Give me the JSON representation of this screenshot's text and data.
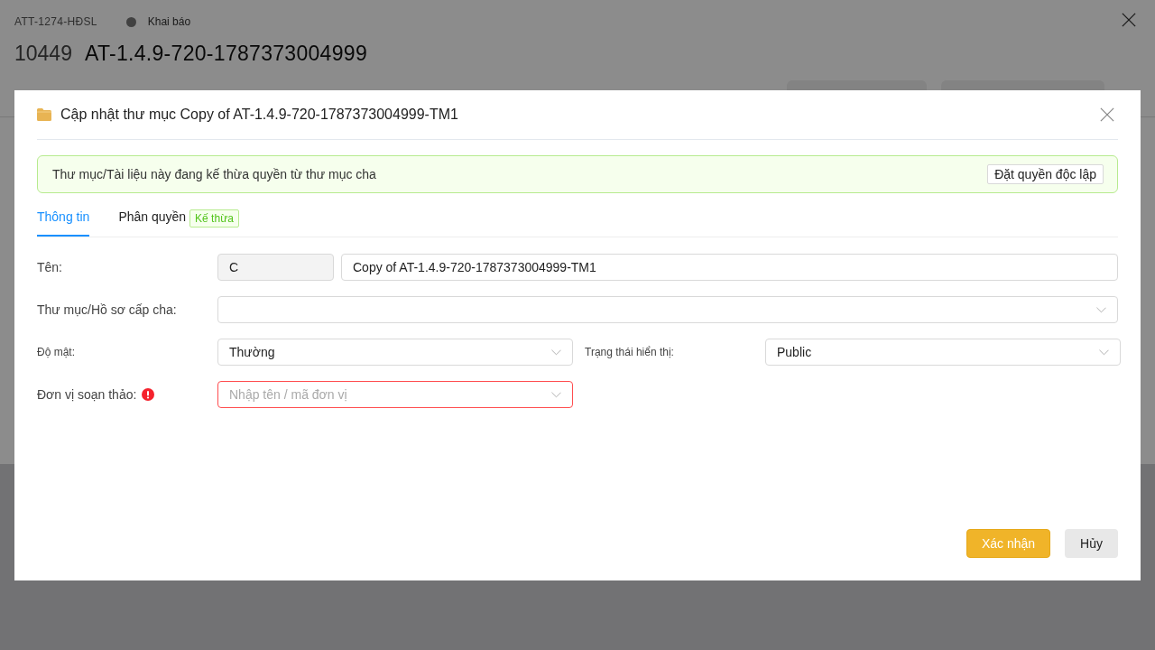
{
  "page": {
    "code": "ATT-1274-HĐSL",
    "status": "Khai báo",
    "number": "10449",
    "title": "AT-1.4.9-720-1787373004999"
  },
  "dialog": {
    "title": "Cập nhật thư mục Copy of AT-1.4.9-720-1787373004999-TM1",
    "alert": {
      "text": "Thư mục/Tài liệu này đang kế thừa quyền từ thư mục cha",
      "button": "Đặt quyền độc lập"
    },
    "tabs": [
      {
        "label": "Thông tin",
        "selected": true
      },
      {
        "label": "Phân quyền",
        "selected": false,
        "badge": "Kế thừa"
      }
    ],
    "rows": [
      {
        "fields": [
          {
            "label": "Tên:",
            "kind": "text",
            "prefix": "C",
            "value": "Copy of AT-1.4.9-720-1787373004999-TM1",
            "error": false
          }
        ]
      },
      {
        "fields": [
          {
            "label": "Thư mục/Hồ sơ cấp cha:",
            "kind": "select",
            "error": false
          }
        ]
      },
      {
        "fields": [
          {
            "label": "Độ mật:",
            "kind": "select",
            "value": "Thường",
            "error": false
          },
          {
            "label": "Trạng thái hiển thị:",
            "kind": "select",
            "value": "Public",
            "error": false
          }
        ]
      },
      {
        "fields": [
          {
            "label": "Đơn vị soạn thảo:",
            "kind": "select",
            "placeholder": "Nhập tên / mã đơn vị",
            "error": true,
            "half": true
          }
        ]
      }
    ],
    "buttons": [
      {
        "label": "Xác nhận",
        "kind": "primary"
      },
      {
        "label": "Hủy",
        "kind": "default"
      }
    ]
  }
}
